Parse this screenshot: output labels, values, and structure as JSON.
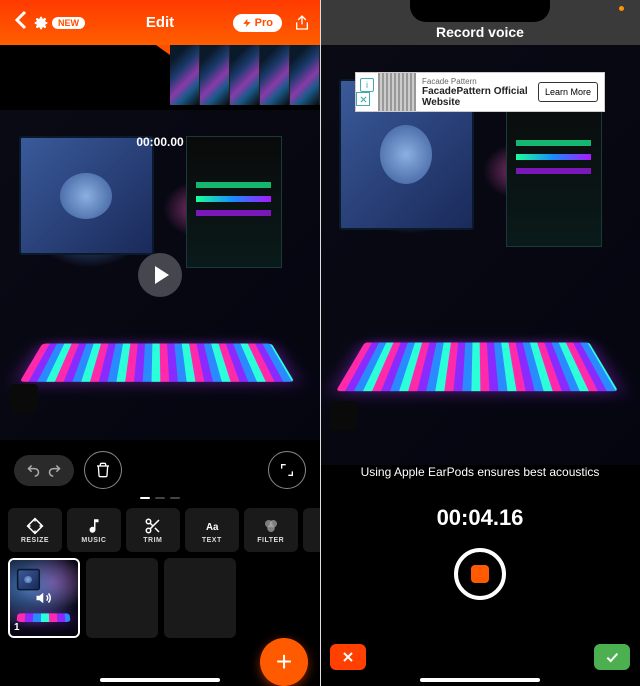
{
  "left": {
    "header": {
      "new_badge": "NEW",
      "title": "Edit",
      "pro_label": "Pro"
    },
    "timer": "00:00.00",
    "tools": {
      "resize": "RESIZE",
      "music": "MUSIC",
      "trim": "TRIM",
      "text": "TEXT",
      "filter": "FILTER"
    },
    "thumbnail": {
      "index": "1"
    },
    "add_label": "+"
  },
  "right": {
    "title": "Record voice",
    "ad": {
      "brand": "Facade Pattern",
      "headline": "FacadePattern Official Website",
      "cta": "Learn More",
      "info": "i"
    },
    "hint": "Using Apple EarPods ensures best acoustics",
    "timer": "00:04.16"
  }
}
